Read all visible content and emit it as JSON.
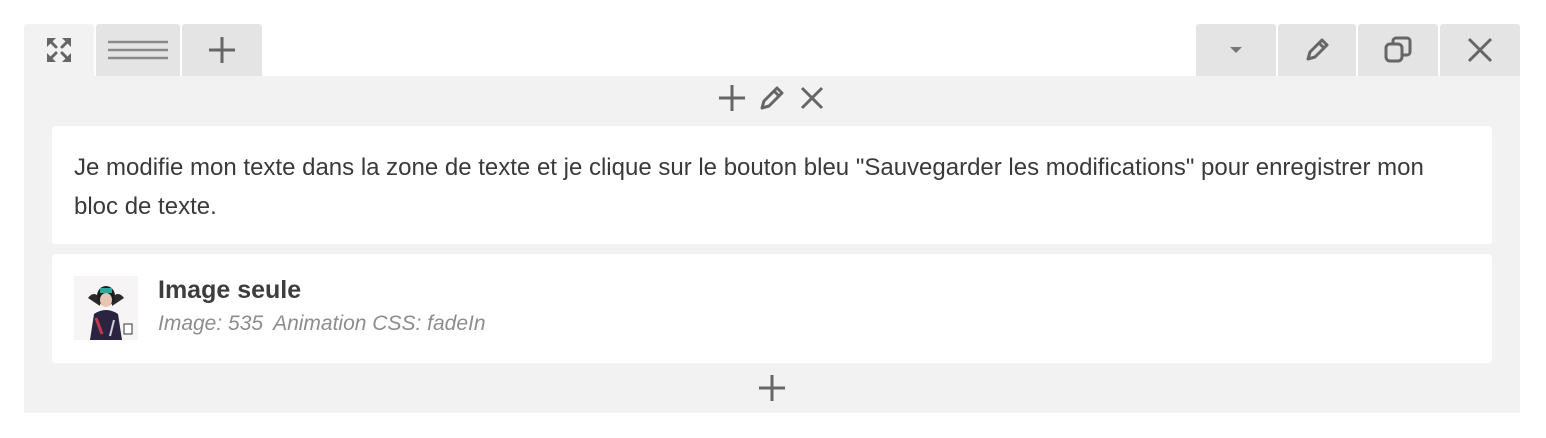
{
  "tabs": {
    "expand_icon": "expand-arrows-icon",
    "list_icon": "list-lines-icon",
    "add_icon": "plus-icon"
  },
  "actions": {
    "dropdown_icon": "caret-down-icon",
    "edit_icon": "pencil-icon",
    "duplicate_icon": "duplicate-icon",
    "close_icon": "close-icon"
  },
  "blocks": {
    "text": {
      "content": "Je modifie mon texte dans la zone de texte et je clique sur le bouton bleu \"Sauvegarder les modifications\" pour enregistrer mon bloc de texte."
    },
    "image": {
      "title": "Image seule",
      "image_meta": "Image: 535",
      "animation_meta": "Animation CSS: fadeIn"
    }
  },
  "colors": {
    "tab_bg": "#e4e4e4",
    "panel_bg": "#f2f2f2",
    "icon": "#666666"
  }
}
